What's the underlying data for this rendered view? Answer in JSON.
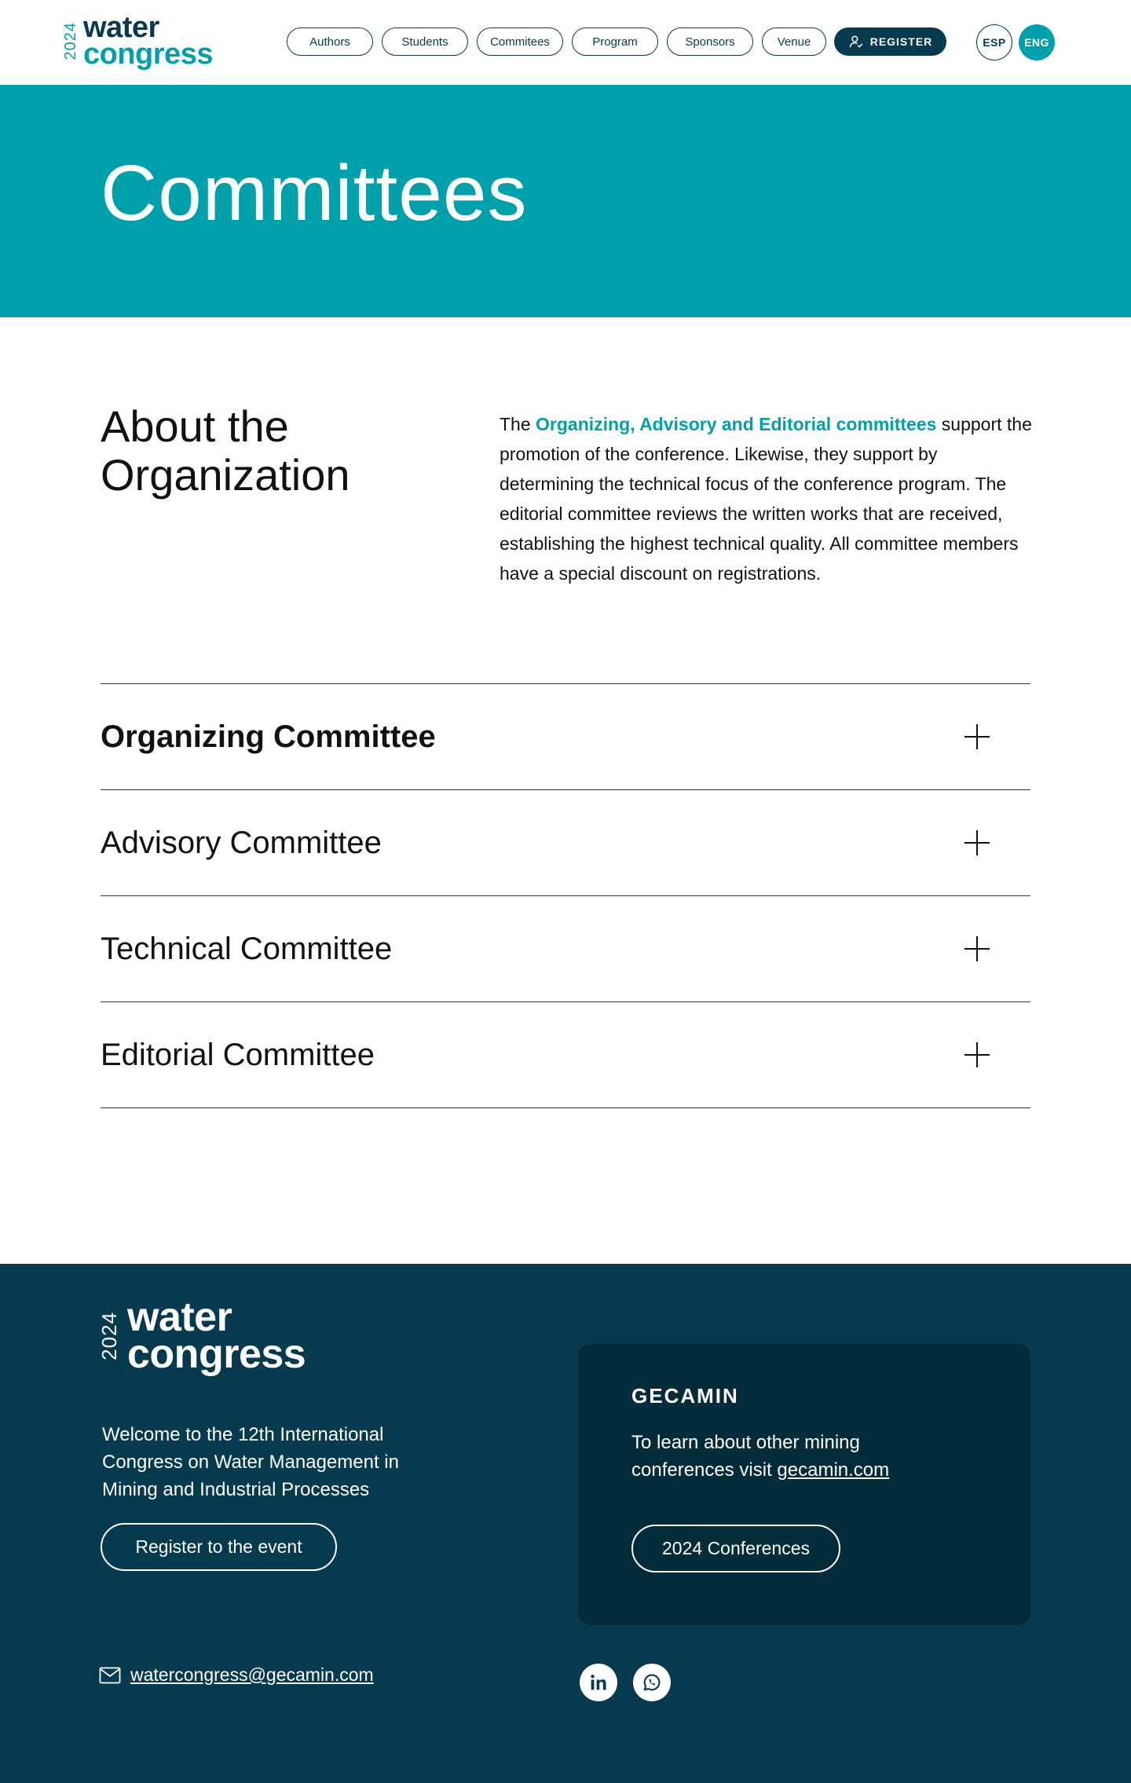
{
  "header": {
    "logo": {
      "year": "2024",
      "word1": "water",
      "word2": "congress"
    },
    "nav": [
      {
        "label": "Authors"
      },
      {
        "label": "Students"
      },
      {
        "label": "Commitees"
      },
      {
        "label": "Program"
      },
      {
        "label": "Sponsors"
      },
      {
        "label": "Venue"
      }
    ],
    "register_label": "REGISTER",
    "languages": [
      {
        "label": "ESP",
        "active": false
      },
      {
        "label": "ENG",
        "active": true
      }
    ]
  },
  "hero": {
    "title": "Committees"
  },
  "about": {
    "title": "About the Organization",
    "text_before": "The ",
    "highlight": "Organizing, Advisory and Editorial committees",
    "text_after": " support the promotion of the conference. Likewise, they support by determining the technical focus of the conference program. The editorial committee reviews the written works that are received, establishing the highest technical quality. All committee members have a special discount on registrations."
  },
  "accordion": [
    {
      "title": "Organizing Committee",
      "active": true
    },
    {
      "title": "Advisory Committee",
      "active": false
    },
    {
      "title": "Technical Committee",
      "active": false
    },
    {
      "title": "Editorial Committee",
      "active": false
    }
  ],
  "footer": {
    "logo": {
      "year": "2024",
      "word1": "water",
      "word2": "congress"
    },
    "welcome": "Welcome to the 12th International Congress on Water Management in Mining and Industrial Processes",
    "register_button": "Register to the event",
    "card": {
      "brand": "GECAMIN",
      "text_before": "To learn about other mining conferences visit ",
      "link": "gecamin.com",
      "button": "2024 Conferences"
    },
    "email": "watercongress@gecamin.com",
    "social": [
      {
        "icon": "linkedin-icon"
      },
      {
        "icon": "whatsapp-icon"
      }
    ]
  },
  "colors": {
    "teal": "#00a0ab",
    "navy": "#063a4f",
    "card": "#032c3b"
  }
}
